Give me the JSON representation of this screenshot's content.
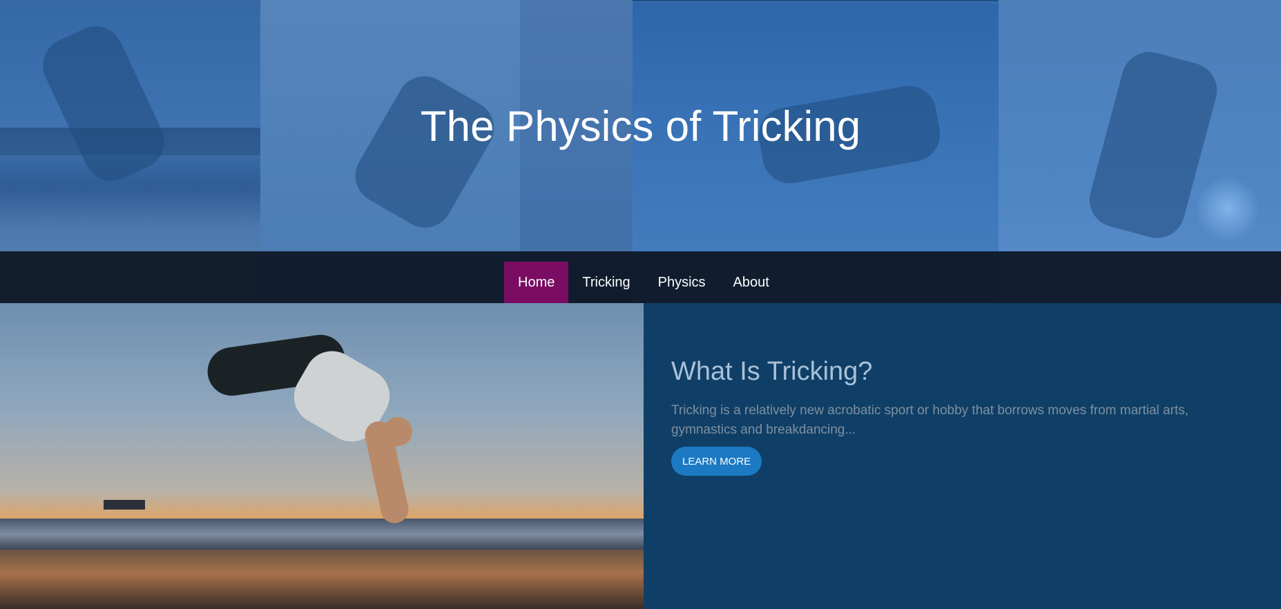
{
  "hero": {
    "title": "The Physics of Tricking"
  },
  "nav": {
    "items": [
      {
        "label": "Home",
        "active": true
      },
      {
        "label": "Tricking",
        "active": false
      },
      {
        "label": "Physics",
        "active": false
      },
      {
        "label": "About",
        "active": false
      }
    ]
  },
  "feature": {
    "title": "What Is Tricking?",
    "text": "Tricking is a relatively new acrobatic sport or hobby that borrows moves from martial arts, gymnastics and breakdancing...",
    "button_label": "LEARN MORE"
  },
  "colors": {
    "hero_tint": "#3a6eaf",
    "nav_bg": "#0d1624",
    "nav_active": "#7a0d63",
    "content_bg": "#0f3f66",
    "button": "#1c7ac2",
    "title_text": "#a9c1d8",
    "body_text": "#7f8fa0"
  }
}
